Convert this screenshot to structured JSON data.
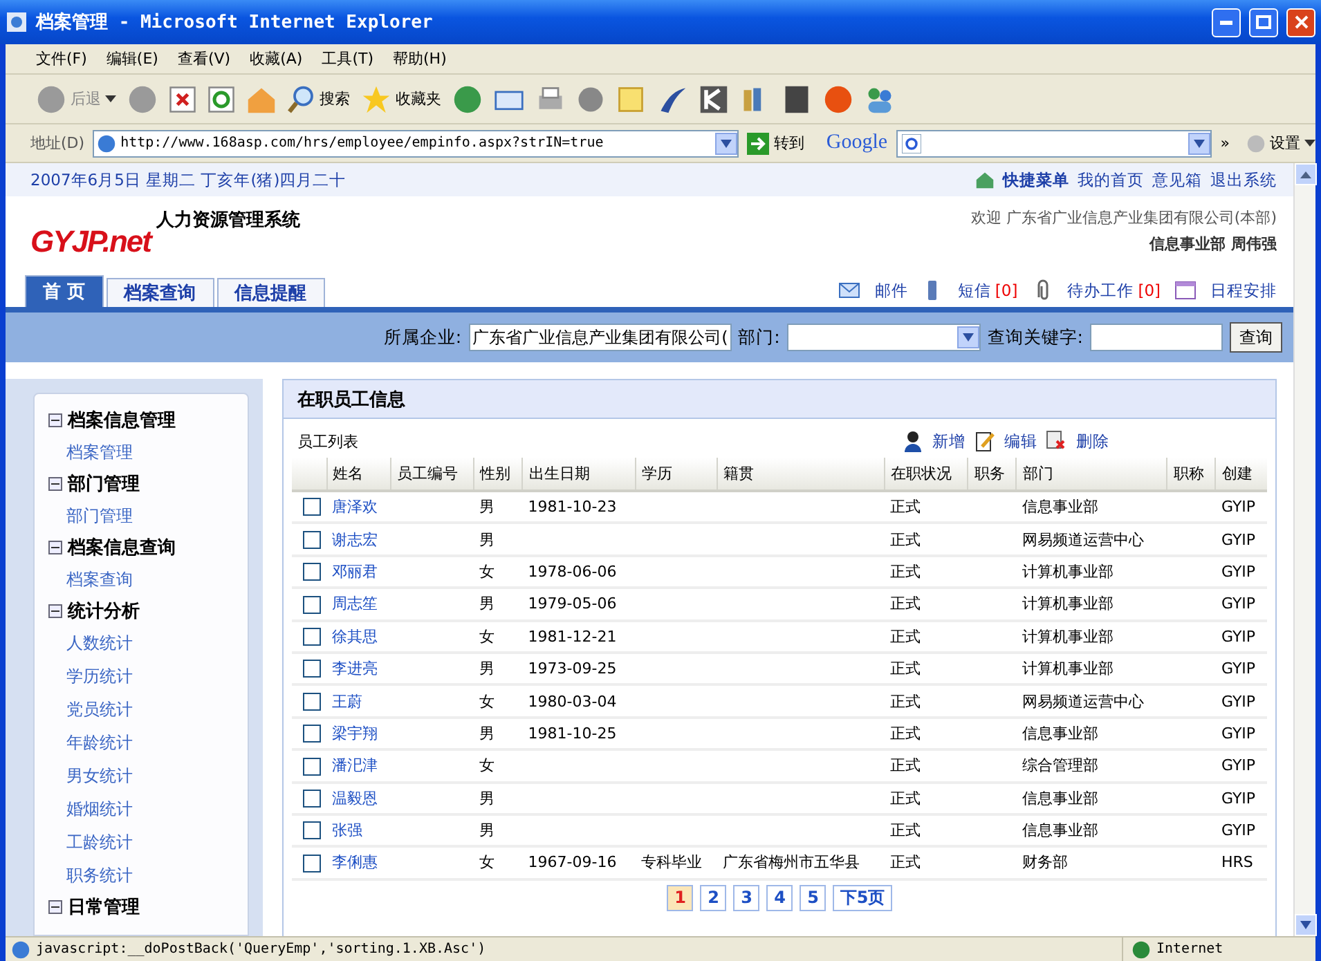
{
  "window": {
    "title": "档案管理 - Microsoft Internet Explorer"
  },
  "menu": [
    "文件(F)",
    "编辑(E)",
    "查看(V)",
    "收藏(A)",
    "工具(T)",
    "帮助(H)"
  ],
  "toolbar": {
    "back": "后退",
    "search": "搜索",
    "favorites": "收藏夹"
  },
  "address_bar": {
    "label": "地址(D)",
    "url": "http://www.168asp.com/hrs/employee/empinfo.aspx?strIN=true",
    "go": "转到",
    "google": "Google",
    "more": "»",
    "settings": "设置"
  },
  "top_strip": {
    "date": "2007年6月5日 星期二 丁亥年(猪)四月二十",
    "quick_menu": "快捷菜单",
    "links": [
      "我的首页",
      "意见箱",
      "退出系统"
    ]
  },
  "header": {
    "logo": "GYJP.net",
    "system_name": "人力资源管理系统",
    "welcome": "欢迎 广东省广业信息产业集团有限公司(本部)",
    "user": "信息事业部 周伟强"
  },
  "tabs": [
    {
      "label": "首 页",
      "selected": true
    },
    {
      "label": "档案查询",
      "selected": false
    },
    {
      "label": "信息提醒",
      "selected": false
    }
  ],
  "notices": [
    {
      "kind": "mail",
      "label": "邮件"
    },
    {
      "kind": "sms",
      "label": "短信",
      "count": "[0]"
    },
    {
      "kind": "todo",
      "label": "待办工作",
      "count": "[0]"
    },
    {
      "kind": "calendar",
      "label": "日程安排"
    }
  ],
  "search": {
    "company_label": "所属企业:",
    "company_value": "广东省广业信息产业集团有限公司(",
    "department_label": "部门:",
    "keyword_label": "查询关键字:",
    "button": "查询"
  },
  "sidebar": [
    {
      "title": "档案信息管理",
      "expanded": true,
      "children": [
        {
          "label": "档案管理"
        }
      ]
    },
    {
      "title": "部门管理",
      "expanded": true,
      "children": [
        {
          "label": "部门管理"
        }
      ]
    },
    {
      "title": "档案信息查询",
      "expanded": true,
      "children": [
        {
          "label": "档案查询"
        }
      ]
    },
    {
      "title": "统计分析",
      "expanded": true,
      "children": [
        {
          "label": "人数统计"
        },
        {
          "label": "学历统计"
        },
        {
          "label": "党员统计"
        },
        {
          "label": "年龄统计"
        },
        {
          "label": "男女统计"
        },
        {
          "label": "婚烟统计"
        },
        {
          "label": "工龄统计"
        },
        {
          "label": "职务统计"
        }
      ]
    },
    {
      "title": "日常管理",
      "expanded": true
    }
  ],
  "panel": {
    "title": "在职员工信息",
    "list_label": "员工列表",
    "actions": [
      {
        "kind": "add",
        "label": "新增"
      },
      {
        "kind": "edit",
        "label": "编辑"
      },
      {
        "kind": "delete",
        "label": "删除"
      }
    ]
  },
  "table": {
    "columns": [
      "姓名",
      "员工编号",
      "性别",
      "出生日期",
      "学历",
      "籍贯",
      "在职状况",
      "职务",
      "部门",
      "职称",
      "创建"
    ],
    "rows": [
      {
        "checked": false,
        "name": "唐泽欢",
        "gender": "男",
        "birth_date": "1981-10-23",
        "status": "正式",
        "department": "信息事业部",
        "creator": "GYIP"
      },
      {
        "checked": false,
        "name": "谢志宏",
        "gender": "男",
        "status": "正式",
        "department": "网易频道运营中心",
        "creator": "GYIP"
      },
      {
        "checked": false,
        "name": "邓丽君",
        "gender": "女",
        "birth_date": "1978-06-06",
        "status": "正式",
        "department": "计算机事业部",
        "creator": "GYIP"
      },
      {
        "checked": false,
        "name": "周志笙",
        "gender": "男",
        "birth_date": "1979-05-06",
        "status": "正式",
        "department": "计算机事业部",
        "creator": "GYIP"
      },
      {
        "checked": false,
        "name": "徐其思",
        "gender": "女",
        "birth_date": "1981-12-21",
        "status": "正式",
        "department": "计算机事业部",
        "creator": "GYIP"
      },
      {
        "checked": false,
        "name": "李进亮",
        "gender": "男",
        "birth_date": "1973-09-25",
        "status": "正式",
        "department": "计算机事业部",
        "creator": "GYIP"
      },
      {
        "checked": false,
        "name": "王蔚",
        "gender": "女",
        "birth_date": "1980-03-04",
        "status": "正式",
        "department": "网易频道运营中心",
        "creator": "GYIP"
      },
      {
        "checked": false,
        "name": "梁宇翔",
        "gender": "男",
        "birth_date": "1981-10-25",
        "status": "正式",
        "department": "信息事业部",
        "creator": "GYIP"
      },
      {
        "checked": false,
        "name": "潘汜津",
        "gender": "女",
        "status": "正式",
        "department": "综合管理部",
        "creator": "GYIP"
      },
      {
        "checked": false,
        "name": "温毅恩",
        "gender": "男",
        "status": "正式",
        "department": "信息事业部",
        "creator": "GYIP"
      },
      {
        "checked": false,
        "name": "张强",
        "gender": "男",
        "status": "正式",
        "department": "信息事业部",
        "creator": "GYIP"
      },
      {
        "checked": false,
        "name": "李俐惠",
        "gender": "女",
        "birth_date": "1967-09-16",
        "education": "专科毕业",
        "native_place": "广东省梅州市五华县",
        "status": "正式",
        "department": "财务部",
        "creator": "HRS"
      }
    ]
  },
  "pagination": [
    {
      "label": "1",
      "selected": true
    },
    {
      "label": "2",
      "selected": false
    },
    {
      "label": "3",
      "selected": false
    },
    {
      "label": "4",
      "selected": false
    },
    {
      "label": "5",
      "selected": false
    },
    {
      "label": "下5页",
      "selected": false
    }
  ],
  "status_bar": {
    "text": "javascript:__doPostBack('QueryEmp','sorting.1.XB.Asc')",
    "zone": "Internet"
  }
}
